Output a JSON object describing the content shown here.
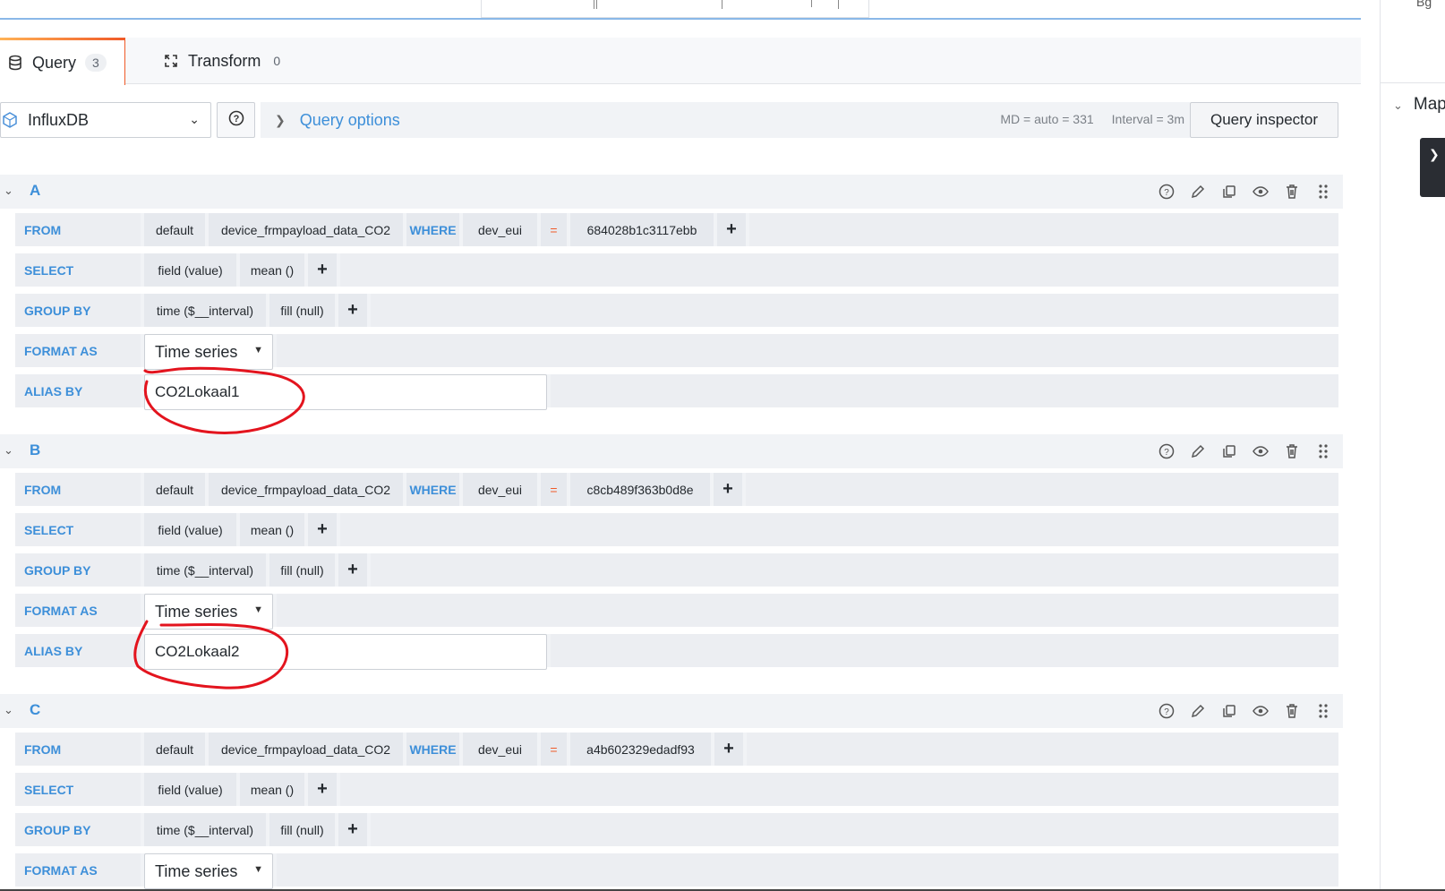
{
  "side_panel": {
    "top_label": "Bg",
    "section_label": "Map"
  },
  "tabs": [
    {
      "label": "Query",
      "count": "3"
    },
    {
      "label": "Transform",
      "count": "0"
    }
  ],
  "datasource": {
    "name": "InfluxDB"
  },
  "query_options": {
    "label": "Query options",
    "md": "MD = auto = 331",
    "interval": "Interval = 3m",
    "inspector_label": "Query inspector"
  },
  "labels": {
    "from": "FROM",
    "select": "SELECT",
    "group_by": "GROUP BY",
    "format_as": "FORMAT AS",
    "alias_by": "ALIAS BY",
    "where": "WHERE"
  },
  "queries": [
    {
      "letter": "A",
      "from": {
        "policy": "default",
        "measurement": "device_frmpayload_data_CO2",
        "tag_key": "dev_eui",
        "operator": "=",
        "tag_value": "684028b1c3117ebb"
      },
      "select": {
        "field": "field (value)",
        "agg": "mean ()"
      },
      "group_by": {
        "time": "time ($__interval)",
        "fill": "fill (null)"
      },
      "format_as": "Time series",
      "alias_by": "CO2Lokaal1"
    },
    {
      "letter": "B",
      "from": {
        "policy": "default",
        "measurement": "device_frmpayload_data_CO2",
        "tag_key": "dev_eui",
        "operator": "=",
        "tag_value": "c8cb489f363b0d8e"
      },
      "select": {
        "field": "field (value)",
        "agg": "mean ()"
      },
      "group_by": {
        "time": "time ($__interval)",
        "fill": "fill (null)"
      },
      "format_as": "Time series",
      "alias_by": "CO2Lokaal2"
    },
    {
      "letter": "C",
      "from": {
        "policy": "default",
        "measurement": "device_frmpayload_data_CO2",
        "tag_key": "dev_eui",
        "operator": "=",
        "tag_value": "a4b602329edadf93"
      },
      "select": {
        "field": "field (value)",
        "agg": "mean ()"
      },
      "group_by": {
        "time": "time ($__interval)",
        "fill": "fill (null)"
      },
      "format_as": "Time series"
    }
  ],
  "colors": {
    "accent_blue": "#3d8fd9",
    "operator_orange": "#f05a28",
    "annotation_red": "#e3141e"
  }
}
